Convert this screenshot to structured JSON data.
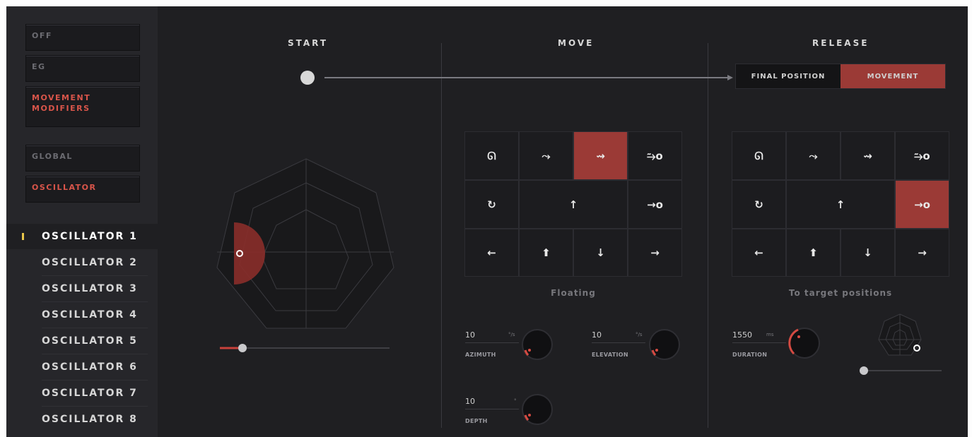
{
  "sidebar": {
    "buttons": [
      {
        "label": "OFF",
        "active": false
      },
      {
        "label": "EG",
        "active": false
      },
      {
        "label": "MOVEMENT\nMODIFIERS",
        "active": true
      },
      {
        "label": "GLOBAL",
        "active": false
      },
      {
        "label": "OSCILLATOR",
        "active": true
      }
    ],
    "oscillators": [
      "OSCILLATOR 1",
      "OSCILLATOR 2",
      "OSCILLATOR 3",
      "OSCILLATOR 4",
      "OSCILLATOR 5",
      "OSCILLATOR 6",
      "OSCILLATOR 7",
      "OSCILLATOR 8"
    ],
    "selected_oscillator": 0
  },
  "columns": {
    "start": "START",
    "move": "MOVE",
    "release": "RELEASE"
  },
  "release_toggle": {
    "options": [
      "FINAL POSITION",
      "MOVEMENT"
    ],
    "active": 1
  },
  "move_grid": {
    "caption": "Floating",
    "active_icon": "jump-arrow-icon",
    "icons": [
      "headphone-loop-icon",
      "wave-arrow-icon",
      "jump-arrow-icon",
      "step-to-target-icon",
      "rotate-icon",
      "up-arrow-icon",
      "to-target-icon",
      "left-arrow-icon",
      "up-double-arrow-icon",
      "down-arrow-icon",
      "right-arrow-icon"
    ],
    "glyphs": [
      "ᘏ",
      "⤳",
      "⇝",
      "⥲o",
      "↻",
      "↑",
      "→o",
      "←",
      "⬆",
      "↓",
      "→"
    ]
  },
  "release_grid": {
    "caption": "To target positions",
    "active_icon": "to-target-icon",
    "icons": [
      "headphone-loop-icon",
      "wave-arrow-icon",
      "jump-arrow-icon",
      "step-to-target-icon",
      "rotate-icon",
      "up-arrow-icon",
      "to-target-icon",
      "left-arrow-icon",
      "up-double-arrow-icon",
      "down-arrow-icon",
      "right-arrow-icon"
    ],
    "glyphs": [
      "ᘏ",
      "⤳",
      "⇝",
      "⥲o",
      "↻",
      "↑",
      "→o",
      "←",
      "⬆",
      "↓",
      "→"
    ]
  },
  "move_params": {
    "azimuth": {
      "value": "10",
      "unit": "°/s",
      "label": "AZIMUTH"
    },
    "elevation": {
      "value": "10",
      "unit": "°/s",
      "label": "ELEVATION"
    },
    "depth": {
      "value": "10",
      "unit": "°",
      "label": "DEPTH"
    }
  },
  "release_params": {
    "duration": {
      "value": "1550",
      "unit": "ms",
      "label": "DURATION"
    }
  },
  "colors": {
    "accent": "#9b3a36",
    "accent_text": "#d9554a",
    "marker": "#e9c64a",
    "background": "#1f1f22"
  }
}
